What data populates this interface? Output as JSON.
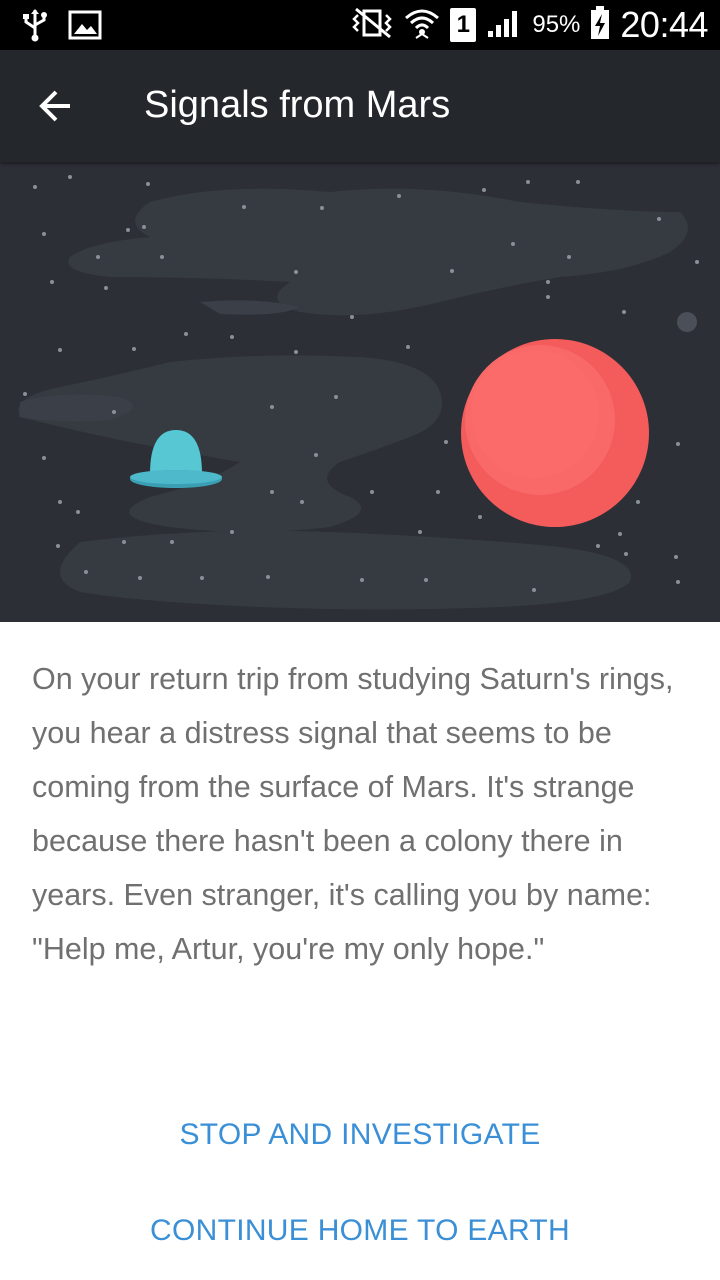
{
  "status_bar": {
    "icons_left": [
      "usb-icon",
      "image-icon"
    ],
    "icons_right": [
      "vibrate-mute-icon",
      "wifi-icon",
      "signal-icon"
    ],
    "sim": "1",
    "battery": "95%",
    "time": "20:44"
  },
  "app_bar": {
    "title": "Signals from Mars"
  },
  "hero": {
    "background_color": "#2c2f36",
    "planet_color": "#f45b5b",
    "ufo_color": "#4fc3cf"
  },
  "story": {
    "text": "On your return trip from studying Saturn's rings, you hear a distress signal that seems to be coming from the surface of Mars. It's strange because there hasn't been a colony there in years. Even stranger, it's calling you by name: \"Help me, Artur, you're my only hope.\""
  },
  "choices": [
    {
      "label": "STOP AND INVESTIGATE"
    },
    {
      "label": "CONTINUE HOME TO EARTH"
    }
  ],
  "colors": {
    "accent": "#3a8fd6",
    "app_bar": "#24272c",
    "body_text": "#707070"
  }
}
